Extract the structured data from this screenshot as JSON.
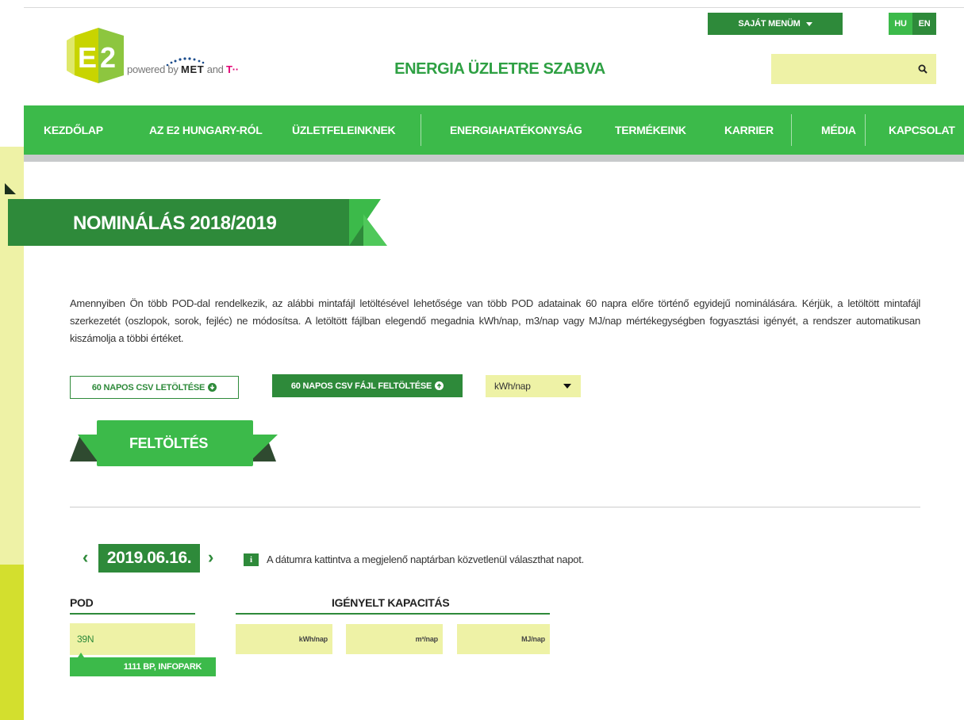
{
  "header": {
    "powered_prefix": "powered by",
    "powered_met": "MET",
    "powered_and": "and",
    "powered_t": "T··",
    "tagline": "ENERGIA ÜZLETRE SZABVA",
    "my_menu": "SAJÁT MENÜM",
    "languages": [
      "HU",
      "EN"
    ],
    "active_language": "HU"
  },
  "nav": {
    "items": [
      "KEZDŐLAP",
      "AZ E2 HUNGARY-RÓL",
      "ÜZLETFELEINKNEK",
      "ENERGIAHATÉKONYSÁG",
      "TERMÉKEINK",
      "KARRIER",
      "MÉDIA",
      "KAPCSOLAT"
    ]
  },
  "page": {
    "title": "NOMINÁLÁS 2018/2019",
    "intro": "Amennyiben Ön több POD-dal rendelkezik, az alábbi mintafájl letöltésével lehetősége van több POD adatainak 60 napra előre történő egyidejű nominálására. Kérjük, a letöltött mintafájl szerkezetét (oszlopok, sorok, fejléc) ne módosítsa. A letöltött fájlban elegendő megadnia kWh/nap, m3/nap vagy MJ/nap mértékegységben fogyasztási igényét, a rendszer automatikusan kiszámolja a többi értéket.",
    "download_button": "60 NAPOS CSV LETÖLTÉSE",
    "upload_file_button": "60 NAPOS CSV FÁJL FELTÖLTÉSE",
    "unit_selected": "kWh/nap",
    "upload_banner": "FELTÖLTÉS"
  },
  "date_nav": {
    "date": "2019.06.16.",
    "hint": "A dátumra kattintva a megjelenő naptárban közvetlenül választhat napot."
  },
  "form": {
    "pod_label": "POD",
    "capacity_label": "IGÉNYELT KAPACITÁS",
    "pod_value": "39N",
    "pod_tooltip": "1111 BP, INFOPARK",
    "unit_kwh": "kWh/nap",
    "unit_m3": "m³/nap",
    "unit_mj": "MJ/nap"
  },
  "colors": {
    "green_dark": "#2e8a3a",
    "green": "#3cba4a",
    "field_yellow": "#eef2a6",
    "stripe_lime": "#d3df2e"
  }
}
